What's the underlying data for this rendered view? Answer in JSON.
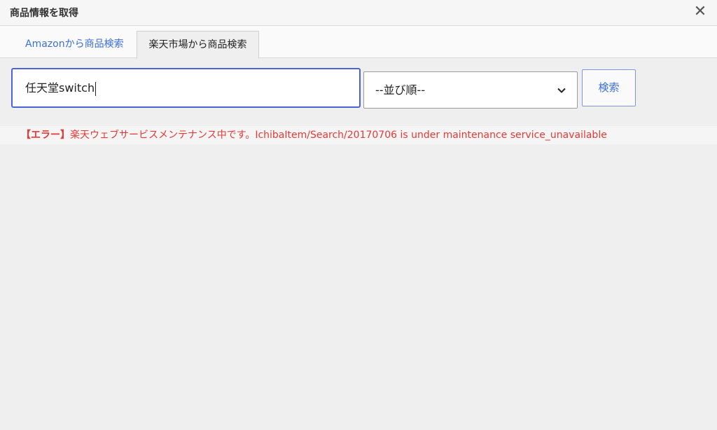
{
  "dialog": {
    "title": "商品情報を取得",
    "close_label": "✕"
  },
  "tabs": [
    {
      "label": "Amazonから商品検索",
      "active": false
    },
    {
      "label": "楽天市場から商品検索",
      "active": true
    }
  ],
  "search": {
    "value": "任天堂switch",
    "sort_selected": "--並び順--",
    "button_label": "検索"
  },
  "error": {
    "label": "【エラー】",
    "message": "楽天ウェブサービスメンテナンス中です。IchibaItem/Search/20170706 is under maintenance service_unavailable"
  },
  "colors": {
    "accent": "#3b6fd8",
    "error": "#e53935",
    "input_focus_border": "#4a63d6"
  }
}
